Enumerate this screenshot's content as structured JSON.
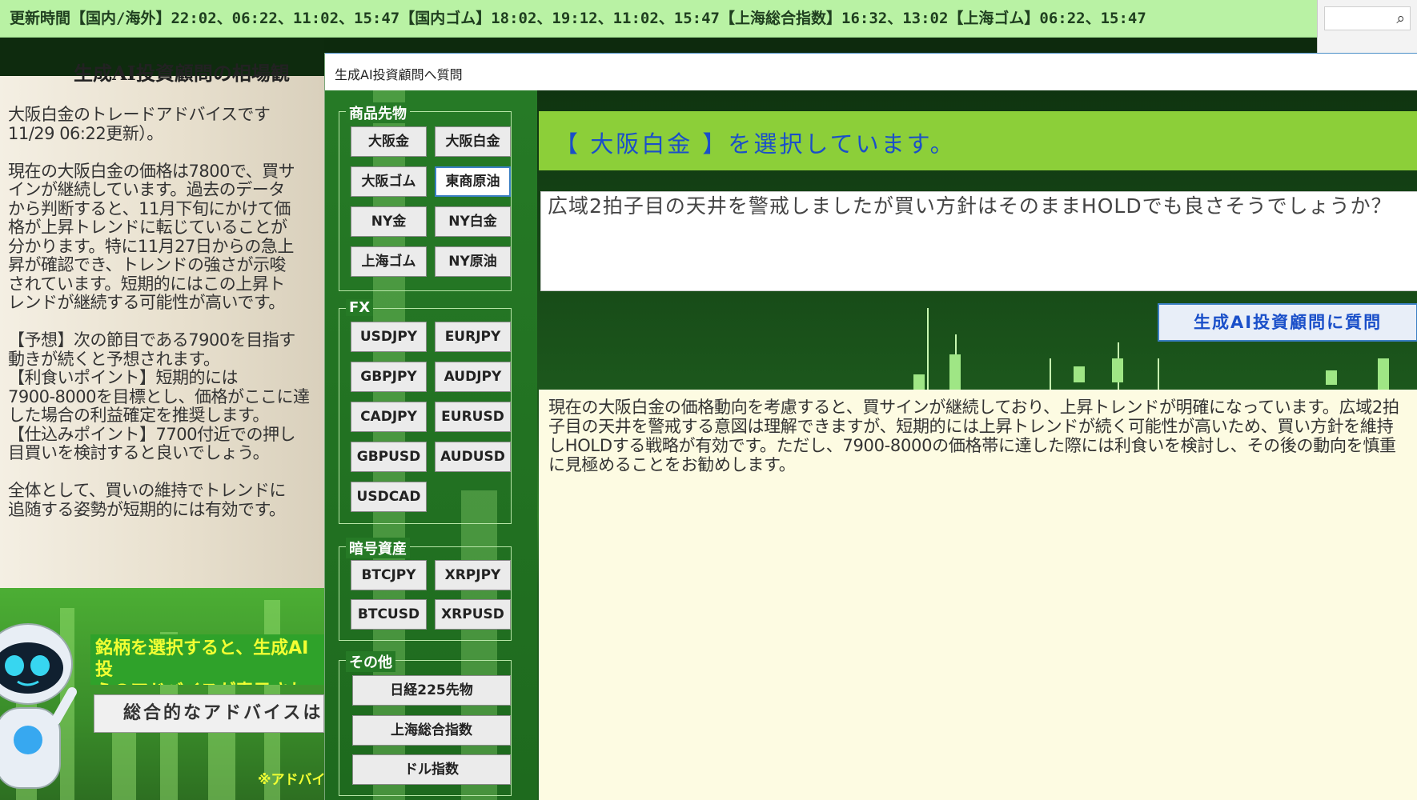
{
  "ticker": {
    "text": "更新時間【国内/海外】22:02、06:22、11:02、15:47【国内ゴム】18:02、19:12、11:02、15:47【上海総合指数】16:32、13:02【上海ゴム】06:22、15:47"
  },
  "search": {
    "icon": "search-icon"
  },
  "left": {
    "title": "生成AI投資顧問の相場観",
    "body": "大阪白金のトレードアドバイスです\n11/29 06:22更新）。\n\n現在の大阪白金の価格は7800で、買サ\nインが継続しています。過去のデータ\nから判断すると、11月下旬にかけて価\n格が上昇トレンドに転じていることが\n分かります。特に11月27日からの急上\n昇が確認でき、トレンドの強さが示唆\nされています。短期的にはこの上昇ト\nレンドが継続する可能性が高いです。\n\n【予想】次の節目である7900を目指す\n動きが続くと予想されます。\n【利食いポイント】短期的には\n7900-8000を目標とし、価格がここに達\nした場合の利益確定を推奨します。\n【仕込みポイント】7700付近での押し\n目買いを検討すると良いでしょう。\n\n全体として、買いの維持でトレンドに\n追随する姿勢が短期的には有効です。",
    "banner": "銘柄を選択すると、生成AI投\nらのアドバイスが表示されます",
    "advice_label": "総合的なアドバイスは",
    "note": "※アドバイ"
  },
  "dialog": {
    "title": "生成AI投資顧問へ質問",
    "groups": {
      "commodities": {
        "label": "商品先物",
        "buttons": [
          "大阪金",
          "大阪白金",
          "大阪ゴム",
          "東商原油",
          "NY金",
          "NY白金",
          "上海ゴム",
          "NY原油"
        ]
      },
      "fx": {
        "label": "FX",
        "buttons": [
          "USDJPY",
          "EURJPY",
          "GBPJPY",
          "AUDJPY",
          "CADJPY",
          "EURUSD",
          "GBPUSD",
          "AUDUSD",
          "USDCAD"
        ]
      },
      "crypto": {
        "label": "暗号資産",
        "buttons": [
          "BTCJPY",
          "XRPJPY",
          "BTCUSD",
          "XRPUSD"
        ]
      },
      "other": {
        "label": "その他",
        "buttons": [
          "日経225先物",
          "上海総合指数",
          "ドル指数"
        ]
      }
    },
    "selected_header": "【 大阪白金 】を選択しています。",
    "question": "広域2拍子目の天井を警戒しましたが買い方針はそのままHOLDでも良さそうでしょうか？",
    "ask_button": "生成AI投資顧問に質問",
    "answer": "現在の大阪白金の価格動向を考慮すると、買サインが継続しており、上昇トレンドが明確になっています。広域2拍子目の天井を警戒する意図は理解できますが、短期的には上昇トレンドが続く可能性が高いため、買い方針を維持しHOLDする戦略が有効です。ただし、7900-8000の価格帯に達した際には利食いを検討し、その後の動向を慎重に見極めることをお勧めします。"
  },
  "colors": {
    "ticker_bg": "#b9f2a4",
    "header_bg": "#8ccf39",
    "header_text": "#1a4fc9",
    "answer_bg": "#fdfbe2",
    "accent": "#3b7fc4"
  }
}
